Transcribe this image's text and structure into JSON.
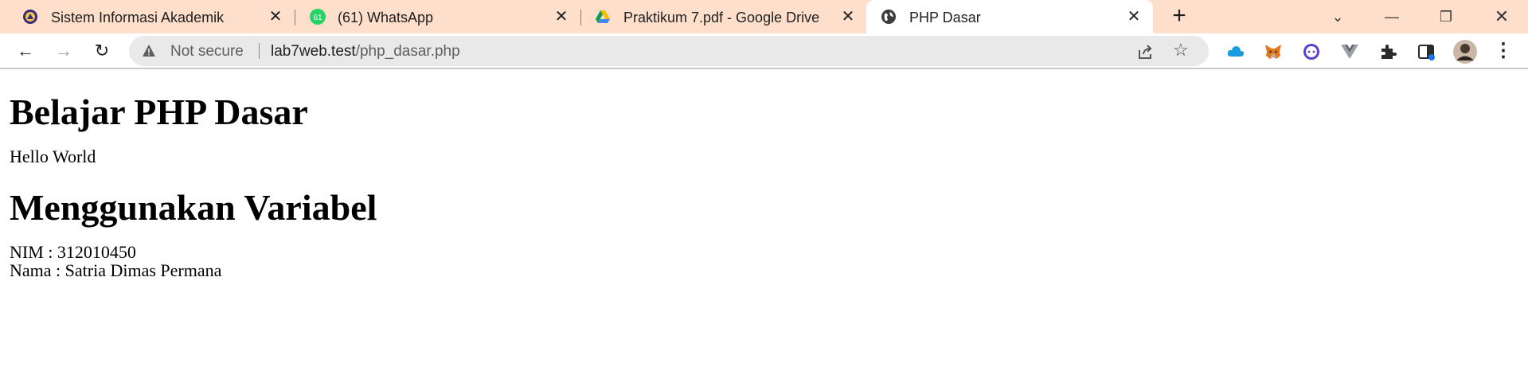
{
  "browser": {
    "tabs": [
      {
        "title": "Sistem Informasi Akademik",
        "icon": "university-logo-icon"
      },
      {
        "title": "(61) WhatsApp",
        "icon": "whatsapp-icon",
        "badge": "61"
      },
      {
        "title": "Praktikum 7.pdf - Google Drive",
        "icon": "google-drive-icon"
      },
      {
        "title": "PHP Dasar",
        "icon": "globe-icon",
        "active": true
      }
    ],
    "new_tab_label": "+",
    "address_bar": {
      "security_label": "Not secure",
      "url_host": "lab7web.test",
      "url_path": "/php_dasar.php"
    },
    "extensions": [
      "cloud-icon",
      "metamask-fox-icon",
      "chat-bubble-icon",
      "vue-icon",
      "puzzle-extensions-icon",
      "sidepanel-icon",
      "profile-avatar",
      "menu-kebab-icon"
    ]
  },
  "page": {
    "heading1": "Belajar PHP Dasar",
    "greeting": "Hello World",
    "heading2": "Menggunakan Variabel",
    "nim_line": "NIM : 312010450",
    "nama_line": "Nama : Satria Dimas Permana"
  },
  "colors": {
    "tabstrip_bg": "#fddfcc",
    "active_tab_bg": "#ffffff",
    "omnibox_bg": "#e9e9e9"
  }
}
